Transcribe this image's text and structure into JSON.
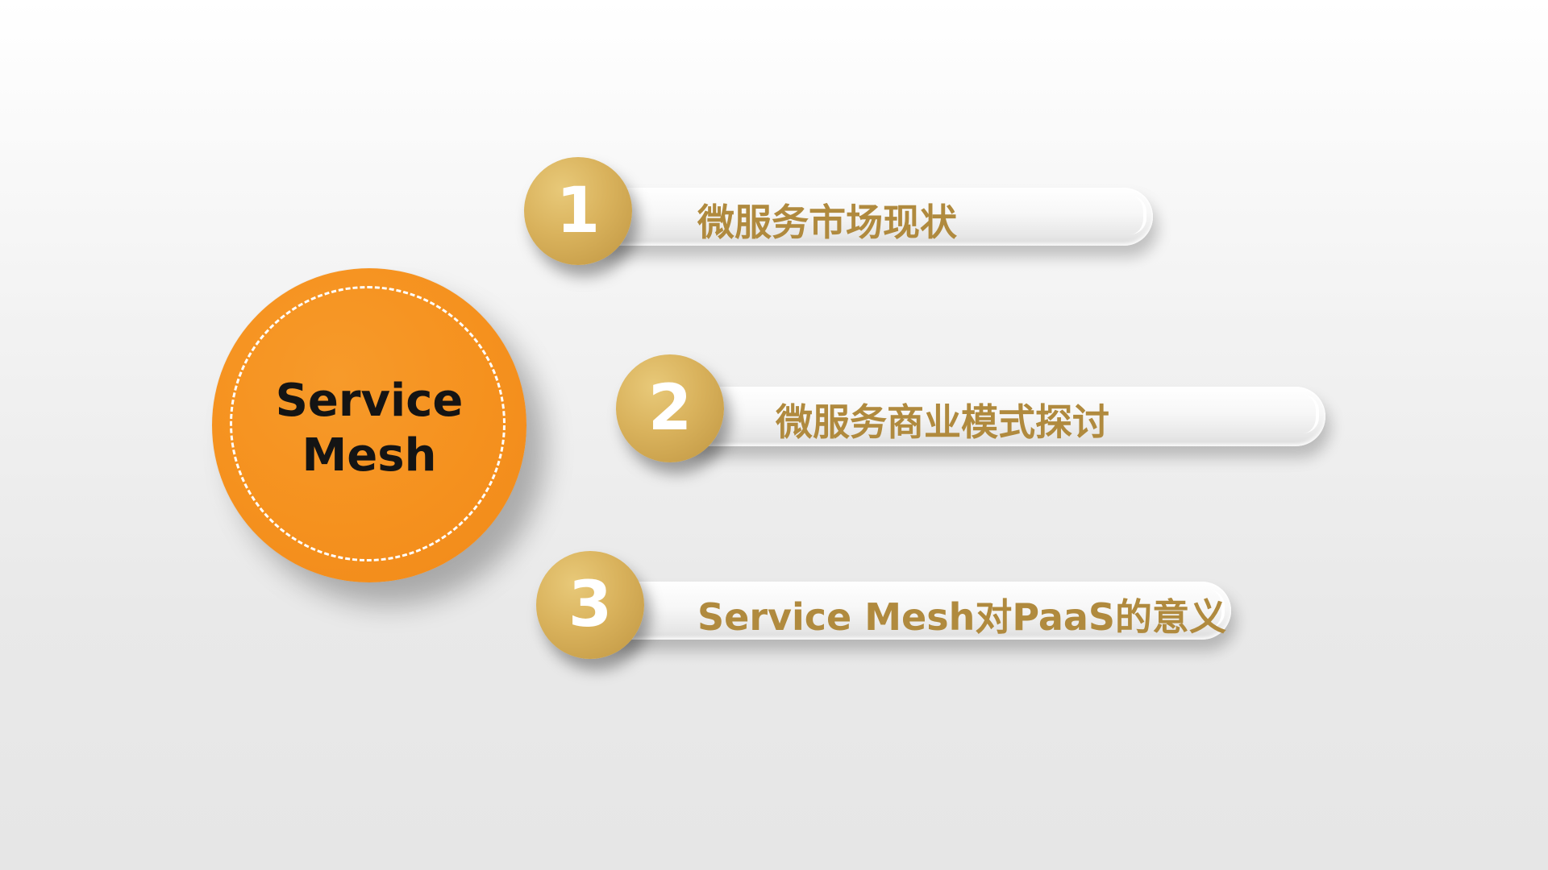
{
  "topic": {
    "line1": "Service",
    "line2": "Mesh",
    "color": "#f5911e"
  },
  "items": [
    {
      "number": "1",
      "label": "微服务市场现状"
    },
    {
      "number": "2",
      "label": "微服务商业模式探讨"
    },
    {
      "number": "3",
      "label": "Service Mesh对PaaS的意义"
    }
  ],
  "colors": {
    "gold": "#d4aa55",
    "label_text": "#b08a3e",
    "orange": "#f5911e"
  }
}
